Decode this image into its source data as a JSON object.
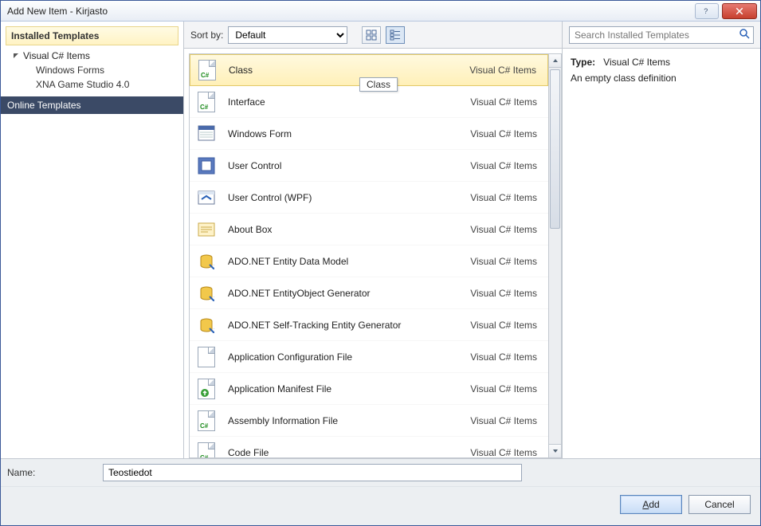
{
  "window": {
    "title": "Add New Item - Kirjasto"
  },
  "sidebar": {
    "installed_header": "Installed Templates",
    "online_header": "Online Templates",
    "root_label": "Visual C# Items",
    "children": [
      "Windows Forms",
      "XNA Game Studio 4.0"
    ]
  },
  "toolbar": {
    "sort_by_label": "Sort by:",
    "sort_value": "Default"
  },
  "search": {
    "placeholder": "Search Installed Templates"
  },
  "tooltip": "Class",
  "details": {
    "type_label": "Type:",
    "type_value": "Visual C# Items",
    "description": "An empty class definition"
  },
  "list": {
    "category": "Visual C# Items",
    "items": [
      {
        "label": "Class",
        "icon": "cs",
        "selected": true
      },
      {
        "label": "Interface",
        "icon": "cs"
      },
      {
        "label": "Windows Form",
        "icon": "form"
      },
      {
        "label": "User Control",
        "icon": "control"
      },
      {
        "label": "User Control (WPF)",
        "icon": "wpf"
      },
      {
        "label": "About Box",
        "icon": "about"
      },
      {
        "label": "ADO.NET Entity Data Model",
        "icon": "db"
      },
      {
        "label": "ADO.NET EntityObject Generator",
        "icon": "db"
      },
      {
        "label": "ADO.NET Self-Tracking Entity Generator",
        "icon": "db"
      },
      {
        "label": "Application Configuration File",
        "icon": "file"
      },
      {
        "label": "Application Manifest File",
        "icon": "manifest"
      },
      {
        "label": "Assembly Information File",
        "icon": "cs"
      },
      {
        "label": "Code File",
        "icon": "cs"
      }
    ]
  },
  "name_field": {
    "label": "Name:",
    "value": "Teostiedot"
  },
  "buttons": {
    "add": "Add",
    "cancel": "Cancel"
  }
}
